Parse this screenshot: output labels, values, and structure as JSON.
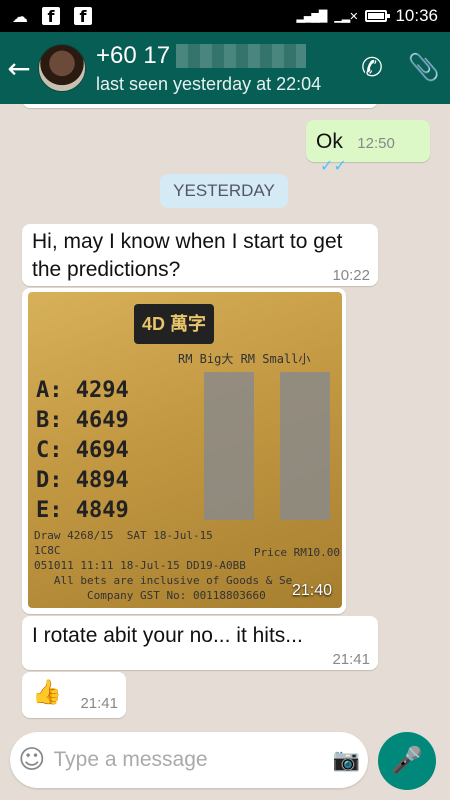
{
  "statusbar": {
    "time": "10:36"
  },
  "header": {
    "contact_prefix": "+60 17",
    "last_seen": "last seen yesterday at 22:04"
  },
  "chat": {
    "out_message": {
      "text": "Ok",
      "time": "12:50"
    },
    "day_separator": "YESTERDAY",
    "message1": {
      "text": "Hi, may I know when I start to get the predictions?",
      "time": "10:22"
    },
    "photo": {
      "brand": "4D 萬字",
      "columns": "RM Big大  RM Small小",
      "numbers": [
        "A: 4294",
        "B: 4649",
        "C: 4694",
        "D: 4894",
        "E: 4849"
      ],
      "info": "Draw 4268/15  SAT 18-Jul-15\n1C8C\n051011 11:11 18-Jul-15 DD19-A0BB\n   All bets are inclusive of Goods & Se\n        Company GST No: 00118803660",
      "price": "Price RM10.00",
      "time": "21:40"
    },
    "message2": {
      "text": "I rotate abit your no... it hits...",
      "time": "21:41"
    },
    "message3": {
      "emoji": "👍",
      "time": "21:41"
    }
  },
  "input": {
    "placeholder": "Type a message"
  },
  "colors": {
    "header": "#075e54",
    "out_bubble": "#dcf8c6",
    "background": "#e5ddd5",
    "mic": "#00897b"
  }
}
